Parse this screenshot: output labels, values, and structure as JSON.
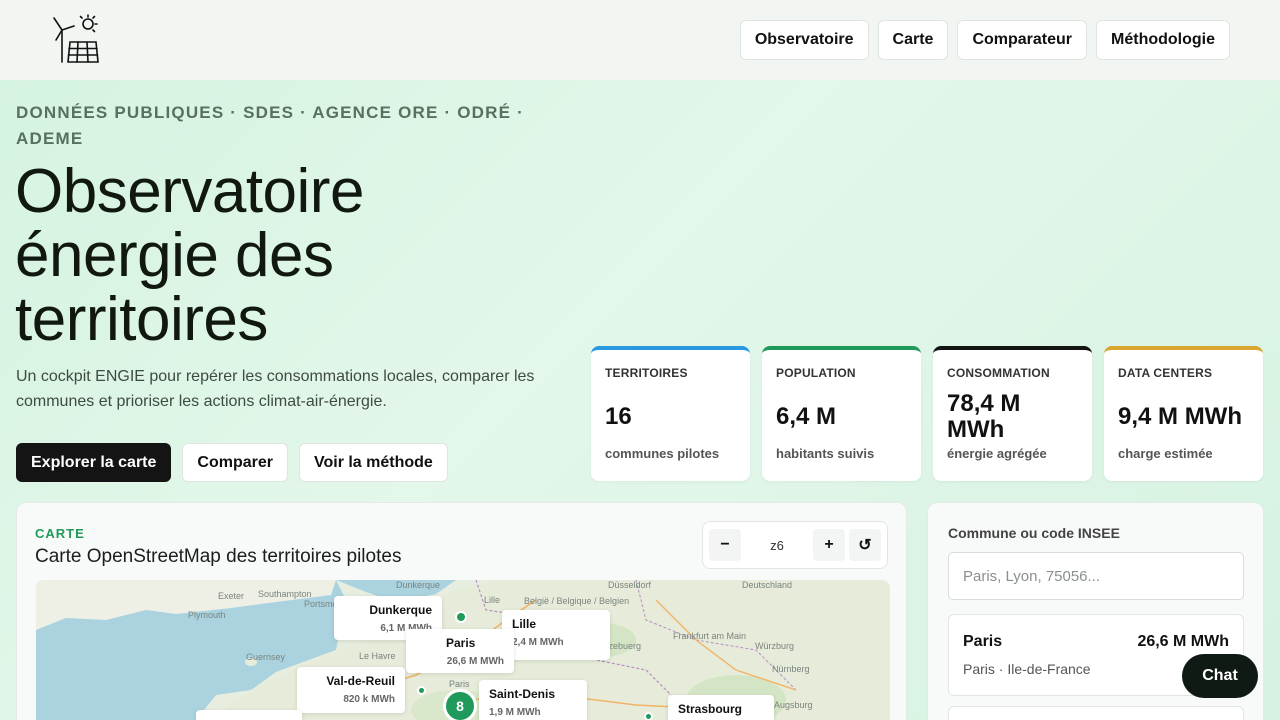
{
  "nav": {
    "items": [
      "Observatoire",
      "Carte",
      "Comparateur",
      "Méthodologie"
    ]
  },
  "hero": {
    "eyebrow": "DONNÉES PUBLIQUES · SDES · AGENCE ORE · ODRÉ · ADEME",
    "title": "Observatoire énergie des territoires",
    "description": "Un cockpit ENGIE pour repérer les consommations locales, comparer les communes et prioriser les actions climat-air-énergie.",
    "actions": [
      "Explorer la carte",
      "Comparer",
      "Voir la méthode"
    ]
  },
  "stats": [
    {
      "label": "TERRITOIRES",
      "value": "16",
      "sub": "communes pilotes",
      "color": "#2a9ae0"
    },
    {
      "label": "POPULATION",
      "value": "6,4 M",
      "sub": "habitants suivis",
      "color": "#1f9a5a"
    },
    {
      "label": "CONSOMMATION",
      "value": "78,4 M MWh",
      "sub": "énergie agrégée",
      "color": "#141414"
    },
    {
      "label": "DATA CENTERS",
      "value": "9,4 M MWh",
      "sub": "charge estimée",
      "color": "#d9a630"
    }
  ],
  "map": {
    "kicker": "CARTE",
    "title": "Carte OpenStreetMap des territoires pilotes",
    "zoom_minus": "−",
    "zoom_level": "z6",
    "zoom_plus": "+",
    "zoom_reset": "↺",
    "cluster_label": "8",
    "places": {
      "dunkerque_town": "Dunkerque",
      "dusseldorf": "Düsseldorf",
      "exeter": "Exeter",
      "southampton": "Southampton",
      "portsmouth": "Portsmouth",
      "plymouth": "Plymouth",
      "lille_town": "Lille",
      "belgie": "België / Belgique / Belgien",
      "deutschland": "Deutschland",
      "guernsey": "Guernsey",
      "le_havre": "Le Havre",
      "frankfurt": "Frankfurt am Main",
      "wurzburg": "Würzburg",
      "nurnberg": "Nürnberg",
      "augsburg": "Augsburg",
      "paris_town": "Paris",
      "luxembourg": "Lëtzebuerg"
    },
    "cities": [
      {
        "name": "Dunkerque",
        "value": "6,1 M MWh"
      },
      {
        "name": "Lille",
        "value": "2,4 M MWh"
      },
      {
        "name": "Paris",
        "value": "26,6 M MWh"
      },
      {
        "name": "Val-de-Reuil",
        "value": "820 k MWh"
      },
      {
        "name": "Saint-Denis",
        "value": "1,9 M MWh"
      },
      {
        "name": "Strasbourg",
        "value": ""
      }
    ]
  },
  "side": {
    "label": "Commune ou code INSEE",
    "search_placeholder": "Paris, Lyon, 75056...",
    "result": {
      "name": "Paris",
      "value": "26,6 M MWh",
      "sub": "Paris · Ile-de-France"
    }
  },
  "chat": {
    "label": "Chat"
  }
}
